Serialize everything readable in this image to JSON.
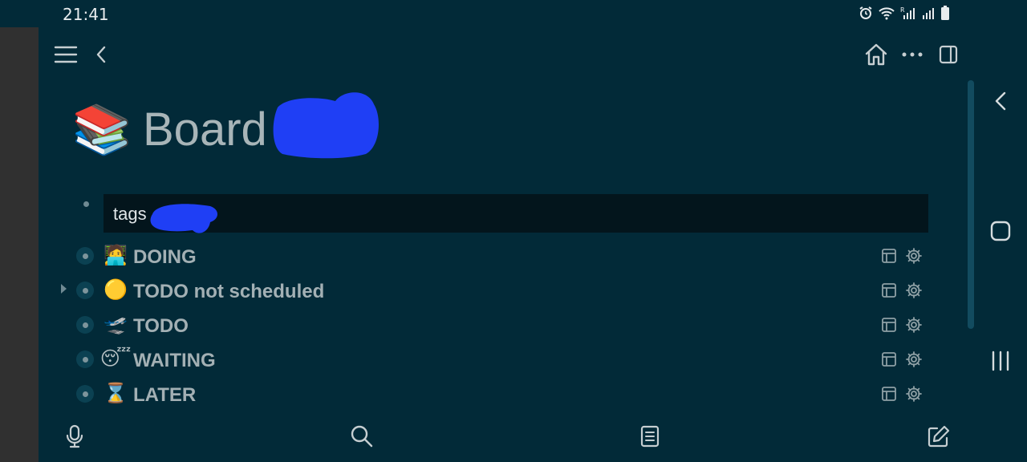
{
  "status_bar": {
    "time": "21:41",
    "icons": [
      "alarm-icon",
      "wifi-icon",
      "signal-roaming-icon",
      "signal-icon",
      "battery-icon"
    ]
  },
  "topbar": {
    "left_icons": [
      "menu-icon",
      "back-icon"
    ],
    "right_icons": [
      "home-icon",
      "more-icon",
      "sidebar-toggle-icon"
    ]
  },
  "page": {
    "emoji": "📚",
    "title": "Board",
    "tags_label": "tags"
  },
  "list": {
    "items": [
      {
        "emoji": "🧑‍💻",
        "label": "DOING",
        "collapsed": false
      },
      {
        "emoji": "🟡",
        "label": "TODO not scheduled",
        "collapsed": true
      },
      {
        "emoji": "🛫",
        "label": "TODO",
        "collapsed": false
      },
      {
        "emoji": "😴",
        "label": "WAITING",
        "collapsed": false
      },
      {
        "emoji": "⌛",
        "label": "LATER",
        "collapsed": false
      }
    ]
  },
  "bottombar": {
    "icons": [
      "microphone-icon",
      "search-icon",
      "journal-icon",
      "edit-icon"
    ]
  },
  "android_nav": {
    "icons": [
      "back-icon",
      "home-icon",
      "recents-icon"
    ]
  },
  "colors": {
    "background": "#022a38",
    "tags_box": "#03151c",
    "redaction": "#1f3ff5",
    "text_muted": "#a3b0b4"
  }
}
